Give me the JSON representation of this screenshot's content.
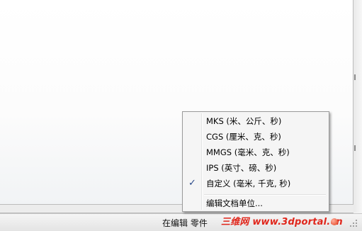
{
  "status_bar": {
    "text": "在编辑 零件",
    "watermark": "三维网 www.3dportal.cn"
  },
  "units_menu": {
    "items": [
      {
        "label": "MKS (米、公斤、秒)",
        "checked": false
      },
      {
        "label": "CGS (厘米、克、秒)",
        "checked": false
      },
      {
        "label": "MMGS (毫米、克、秒)",
        "checked": false
      },
      {
        "label": "IPS (英寸、磅、秒)",
        "checked": false
      },
      {
        "label": "自定义 (毫米, 千克, 秒)",
        "checked": true
      }
    ],
    "check_mark": "✓",
    "edit_units_label": "编辑文档单位..."
  },
  "icons": {
    "check": "check-icon",
    "status": "status-indicator-icon",
    "grip": "resize-grip-icon"
  },
  "colors": {
    "menu_background": "#f5f5f5",
    "menu_border": "#9a9a9a",
    "watermark": "#e0261b"
  }
}
